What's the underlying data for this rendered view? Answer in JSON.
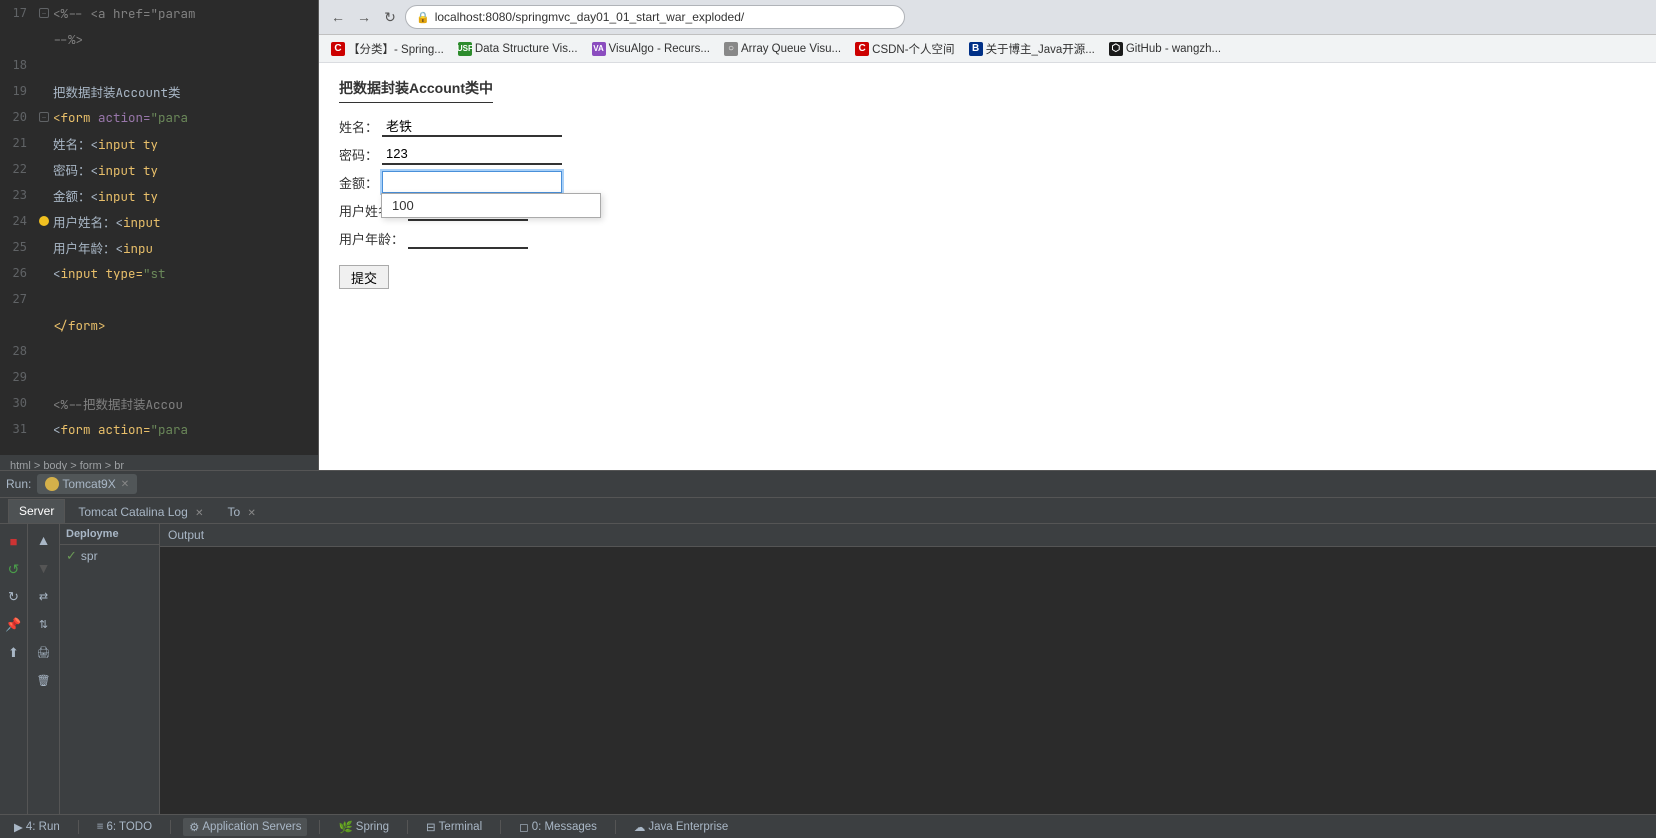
{
  "ide": {
    "lines": [
      {
        "num": "17",
        "has_gutter": "fold",
        "content_parts": [
          {
            "text": "<%--  ",
            "class": "code-comment"
          },
          {
            "text": "<a href=\"param",
            "class": "code-comment"
          }
        ]
      },
      {
        "num": "",
        "has_gutter": "none",
        "content_parts": [
          {
            "text": "--%>",
            "class": "code-comment"
          }
        ]
      },
      {
        "num": "18",
        "has_gutter": "none",
        "content_parts": []
      },
      {
        "num": "19",
        "has_gutter": "none",
        "content_parts": [
          {
            "text": "把数据封装Account类",
            "class": "code-white"
          }
        ]
      },
      {
        "num": "20",
        "has_gutter": "fold",
        "content_parts": [
          {
            "text": "<",
            "class": "code-tag"
          },
          {
            "text": "form ",
            "class": "code-tag"
          },
          {
            "text": "action=",
            "class": "code-attr"
          },
          {
            "text": "\"para",
            "class": "code-val"
          }
        ]
      },
      {
        "num": "21",
        "has_gutter": "none",
        "content_parts": [
          {
            "text": "  姓名：<",
            "class": "code-white"
          },
          {
            "text": "input ty",
            "class": "code-tag"
          }
        ]
      },
      {
        "num": "22",
        "has_gutter": "none",
        "content_parts": [
          {
            "text": "  密码：<",
            "class": "code-white"
          },
          {
            "text": "input ty",
            "class": "code-tag"
          }
        ]
      },
      {
        "num": "23",
        "has_gutter": "none",
        "content_parts": [
          {
            "text": "  金额：<",
            "class": "code-white"
          },
          {
            "text": "input ty",
            "class": "code-tag"
          }
        ]
      },
      {
        "num": "24",
        "has_gutter": "dot",
        "content_parts": [
          {
            "text": "  用户姓名：<",
            "class": "code-white"
          },
          {
            "text": "input",
            "class": "code-tag"
          }
        ]
      },
      {
        "num": "25",
        "has_gutter": "none",
        "content_parts": [
          {
            "text": "  用户年龄：<",
            "class": "code-white"
          },
          {
            "text": "input",
            "class": "code-tag"
          }
        ]
      },
      {
        "num": "26",
        "has_gutter": "none",
        "content_parts": [
          {
            "text": "  <",
            "class": "code-white"
          },
          {
            "text": "input type=",
            "class": "code-tag"
          },
          {
            "text": "\"st",
            "class": "code-val"
          }
        ]
      },
      {
        "num": "27",
        "has_gutter": "none",
        "content_parts": []
      },
      {
        "num": "",
        "has_gutter": "none",
        "content_parts": [
          {
            "text": "</",
            "class": "code-tag"
          },
          {
            "text": "form",
            "class": "code-tag"
          },
          {
            "text": ">",
            "class": "code-tag"
          }
        ]
      },
      {
        "num": "28",
        "has_gutter": "none",
        "content_parts": []
      },
      {
        "num": "29",
        "has_gutter": "none",
        "content_parts": []
      },
      {
        "num": "30",
        "has_gutter": "none",
        "content_parts": [
          {
            "text": "<%--把数据封装Accou",
            "class": "code-comment"
          }
        ]
      },
      {
        "num": "31",
        "has_gutter": "none",
        "content_parts": [
          {
            "text": "  <",
            "class": "code-white"
          },
          {
            "text": "form action=",
            "class": "code-tag"
          },
          {
            "text": "\"para",
            "class": "code-val"
          }
        ]
      }
    ],
    "breadcrumb": "html > body > form > br"
  },
  "browser": {
    "url": "localhost:8080/springmvc_day01_01_start_war_exploded/",
    "bookmarks": [
      {
        "icon": "C",
        "color": "red",
        "label": "【分类】- Spring..."
      },
      {
        "icon": "USF",
        "color": "green",
        "label": "Data Structure Vis..."
      },
      {
        "icon": "VA",
        "color": "purple",
        "label": "VisuAlgo - Recurs..."
      },
      {
        "icon": "○",
        "color": "gray",
        "label": "Array Queue Visu..."
      },
      {
        "icon": "C",
        "color": "red",
        "label": "CSDN-个人空间"
      },
      {
        "icon": "B",
        "color": "dark-blue",
        "label": "关于博主_Java开源..."
      },
      {
        "icon": "○",
        "color": "black",
        "label": "GitHub - wangzh..."
      }
    ],
    "page": {
      "title": "把数据封装Account类中",
      "fields": [
        {
          "label": "姓名：",
          "value": "老铁",
          "type": "text"
        },
        {
          "label": "密码：",
          "value": "123",
          "type": "text"
        },
        {
          "label": "金额：",
          "value": "",
          "type": "text",
          "focused": true
        },
        {
          "label": "用户姓",
          "value": "",
          "type": "text"
        },
        {
          "label": "用户年",
          "value": "",
          "type": "text"
        }
      ],
      "autocomplete_value": "100",
      "submit_label": "提交"
    }
  },
  "run_panel": {
    "run_label": "Run:",
    "tabs": [
      {
        "label": "Tomcat9X",
        "active": true,
        "closable": true
      }
    ],
    "panel_tabs": [
      {
        "label": "Server",
        "active": true
      },
      {
        "label": "Tomcat Catalina Log",
        "active": false,
        "closable": true
      },
      {
        "label": "To",
        "active": false,
        "closable": true
      }
    ],
    "dep_header": "Deployme",
    "dep_item_label": "spr",
    "output_header": "Output"
  },
  "status_bar": {
    "items": [
      {
        "icon": "▶",
        "label": "4: Run"
      },
      {
        "icon": "≡",
        "label": "6: TODO"
      },
      {
        "icon": "⚙",
        "label": "Application Servers"
      },
      {
        "icon": "🌱",
        "label": "Spring"
      },
      {
        "icon": "⊟",
        "label": "Terminal"
      },
      {
        "icon": "◻",
        "label": "0: Messages"
      },
      {
        "icon": "☁",
        "label": "Java Enterprise"
      }
    ]
  }
}
